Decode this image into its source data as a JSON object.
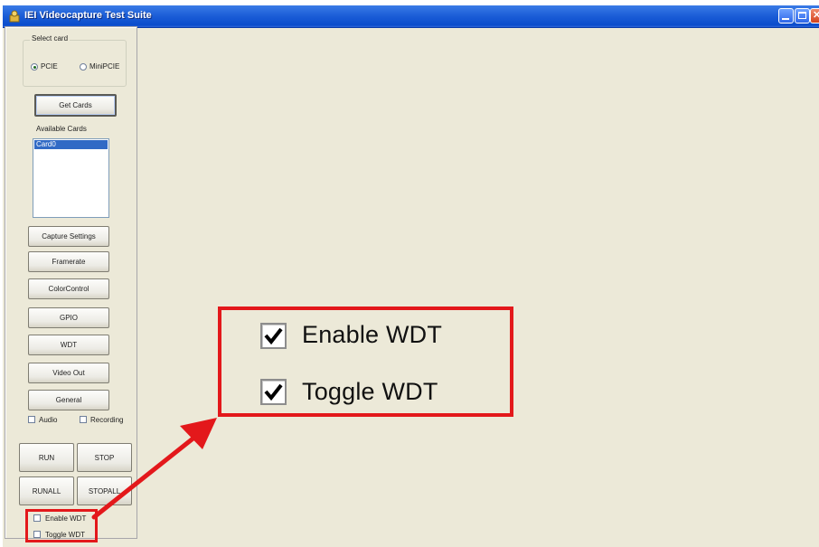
{
  "window": {
    "title": "IEI Videocapture Test Suite"
  },
  "select_card": {
    "label": "Select card",
    "options": [
      {
        "label": "PCIE",
        "selected": true
      },
      {
        "label": "MiniPCIE",
        "selected": false
      }
    ]
  },
  "buttons": {
    "get_cards": "Get Cards",
    "capture_settings": "Capture Settings",
    "framerate": "Framerate",
    "color_control": "ColorControl",
    "gpio": "GPIO",
    "wdt": "WDT",
    "video_out": "Video Out",
    "general": "General",
    "run": "RUN",
    "stop": "STOP",
    "runall": "RUNALL",
    "stopall": "STOPALL"
  },
  "available_cards": {
    "label": "Available Cards",
    "items": [
      "Card0"
    ],
    "selected_index": 0
  },
  "options": {
    "audio": {
      "label": "Audio",
      "checked": false
    },
    "recording": {
      "label": "Recording",
      "checked": false
    },
    "enable_wdt": {
      "label": "Enable WDT",
      "checked": false
    },
    "toggle_wdt": {
      "label": "Toggle WDT",
      "checked": false
    }
  },
  "zoom_callout": {
    "enable_wdt": {
      "label": "Enable WDT",
      "checked": true
    },
    "toggle_wdt": {
      "label": "Toggle WDT",
      "checked": true
    },
    "highlight_color": "#e3181b"
  },
  "colors": {
    "titlebar": "#0a4ccc",
    "window_bg": "#ece9d8",
    "selection": "#316ac5"
  }
}
